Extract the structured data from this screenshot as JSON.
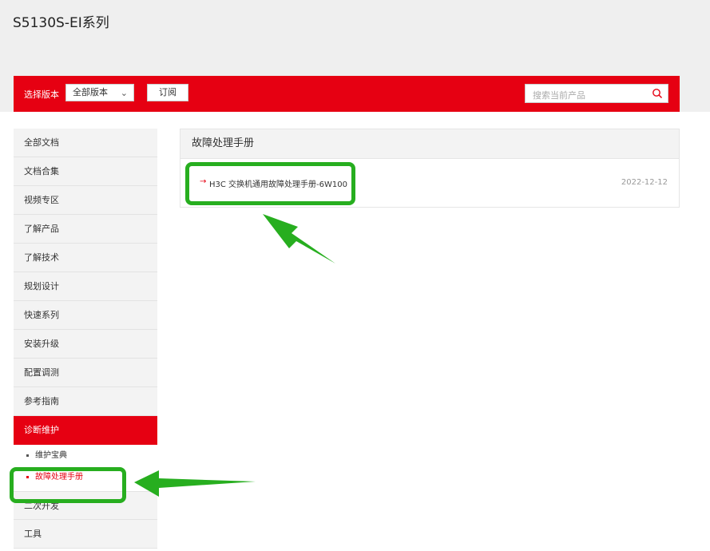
{
  "page": {
    "title": "S5130S-EI系列"
  },
  "toolbar": {
    "version_label": "选择版本",
    "version_select": "全部版本",
    "subscribe": "订阅",
    "search_placeholder": "搜索当前产品"
  },
  "sidebar": {
    "items": [
      "全部文档",
      "文档合集",
      "视频专区",
      "了解产品",
      "了解技术",
      "规划设计",
      "快速系列",
      "安装升级",
      "配置调测",
      "参考指南"
    ],
    "active": "诊断维护",
    "sub_items": [
      "维护宝典",
      "故障处理手册"
    ],
    "after_items": [
      "二次开发",
      "工具"
    ]
  },
  "panel": {
    "title": "故障处理手册",
    "doc": {
      "title": "H3C 交换机通用故障处理手册-6W100",
      "date": "2022-12-12"
    }
  },
  "colors": {
    "brand_red": "#e60012",
    "highlight_green": "#27ae1f"
  }
}
